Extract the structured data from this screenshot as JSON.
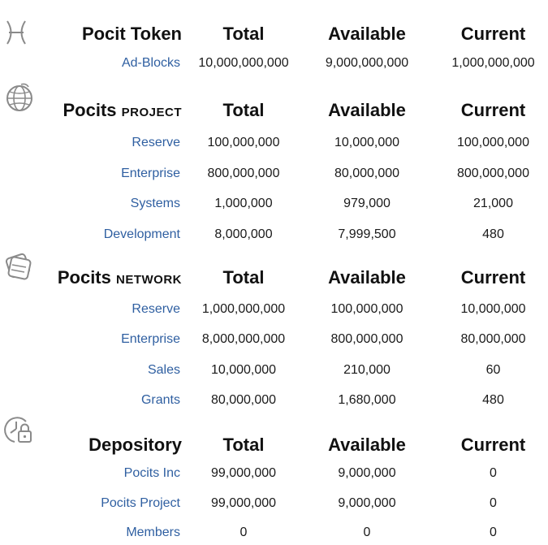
{
  "sections": [
    {
      "icon": "pisces-glyph-icon",
      "title": "Pocit Token",
      "title_suffix": "",
      "headers": {
        "total": "Total",
        "available": "Available",
        "current": "Current"
      },
      "rows": [
        {
          "label": "Ad-Blocks",
          "total": "10,000,000,000",
          "available": "9,000,000,000",
          "current": "1,000,000,000"
        }
      ]
    },
    {
      "icon": "globe-icon",
      "title": "Pocits",
      "title_suffix": "PROJECT",
      "headers": {
        "total": "Total",
        "available": "Available",
        "current": "Current"
      },
      "rows": [
        {
          "label": "Reserve",
          "total": "100,000,000",
          "available": "10,000,000",
          "current": "100,000,000"
        },
        {
          "label": "Enterprise",
          "total": "800,000,000",
          "available": "80,000,000",
          "current": "800,000,000"
        },
        {
          "label": "Systems",
          "total": "1,000,000",
          "available": "979,000",
          "current": "21,000"
        },
        {
          "label": "Development",
          "total": "8,000,000",
          "available": "7,999,500",
          "current": "480"
        }
      ]
    },
    {
      "icon": "stacked-cards-icon",
      "title": "Pocits",
      "title_suffix": "NETWORK",
      "headers": {
        "total": "Total",
        "available": "Available",
        "current": "Current"
      },
      "rows": [
        {
          "label": "Reserve",
          "total": "1,000,000,000",
          "available": "100,000,000",
          "current": "10,000,000"
        },
        {
          "label": "Enterprise",
          "total": "8,000,000,000",
          "available": "800,000,000",
          "current": "80,000,000"
        },
        {
          "label": "Sales",
          "total": "10,000,000",
          "available": "210,000",
          "current": "60"
        },
        {
          "label": "Grants",
          "total": "80,000,000",
          "available": "1,680,000",
          "current": "480"
        }
      ]
    },
    {
      "icon": "clock-lock-icon",
      "title": "Depository",
      "title_suffix": "",
      "headers": {
        "total": "Total",
        "available": "Available",
        "current": "Current"
      },
      "rows": [
        {
          "label": "Pocits Inc",
          "total": "99,000,000",
          "available": "9,000,000",
          "current": "0"
        },
        {
          "label": "Pocits Project",
          "total": "99,000,000",
          "available": "9,000,000",
          "current": "0"
        },
        {
          "label": "Members",
          "total": "0",
          "available": "0",
          "current": "0"
        }
      ]
    }
  ]
}
